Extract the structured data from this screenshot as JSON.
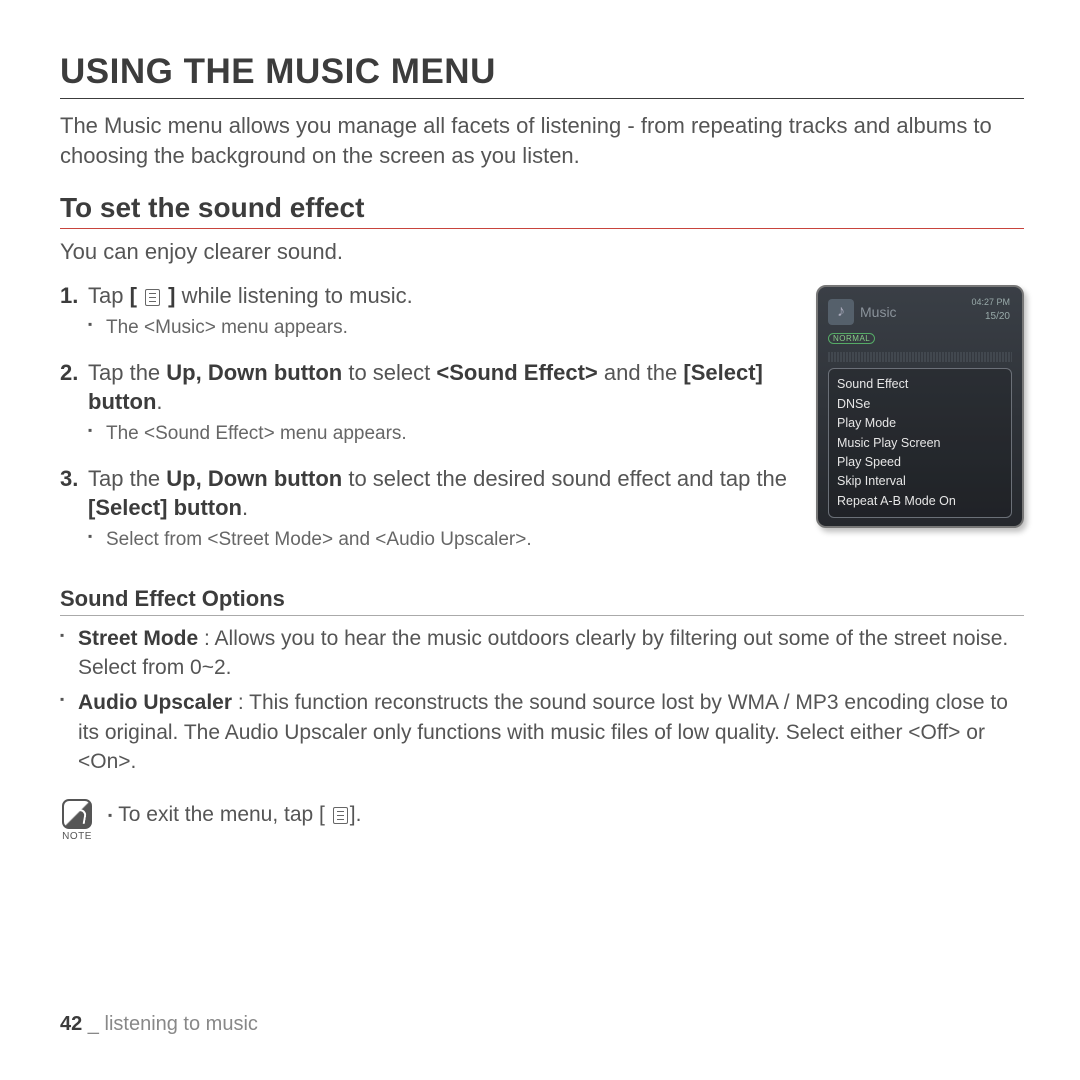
{
  "page": {
    "title": "USING THE MUSIC MENU",
    "intro": "The Music menu allows you manage all facets of listening - from repeating tracks and albums to choosing the background on the screen as you listen.",
    "section_title": "To set the sound effect",
    "lead": "You can enjoy clearer sound.",
    "options_title": "Sound Effect Options",
    "note_label": "NOTE",
    "note_text_before": "To exit the menu, tap [",
    "note_text_after": "].",
    "page_number": "42",
    "footer_separator": " _ ",
    "footer_section": "listening to music"
  },
  "steps": [
    {
      "prefix": "Tap ",
      "bold_open": "[ ",
      "bold_close": " ]",
      "suffix": " while listening to music.",
      "sub": "The <Music> menu appears."
    },
    {
      "full_html": "Tap the <b>Up, Down button</b> to select <b>&lt;Sound Effect&gt;</b> and the <b>[Select] button</b>.",
      "sub": "The <Sound Effect> menu appears."
    },
    {
      "full_html": "Tap the <b>Up, Down button</b> to select the desired sound effect and tap the <b>[Select] button</b>.",
      "sub": "Select from <Street Mode> and <Audio Upscaler>."
    }
  ],
  "options": [
    {
      "name": "Street Mode",
      "desc": " : Allows you to hear the music outdoors clearly by filtering out some of the street noise. Select from 0~2."
    },
    {
      "name": "Audio Upscaler",
      "desc": " : This function reconstructs the sound source lost by WMA / MP3 encoding close to its original. The Audio Upscaler only functions with music files of low quality. Select either <Off> or <On>."
    }
  ],
  "device": {
    "title": "Music",
    "time": "04:27 PM",
    "count": "15/20",
    "badge": "NORMAL",
    "menu": [
      "Sound Effect",
      "DNSe",
      "Play Mode",
      "Music Play Screen",
      "Play Speed",
      "Skip Interval",
      "Repeat A-B Mode On"
    ]
  }
}
